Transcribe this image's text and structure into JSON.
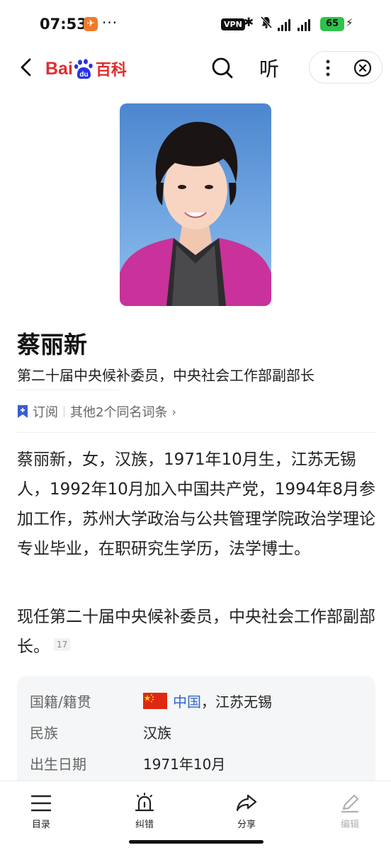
{
  "status_bar": {
    "time": "07:53",
    "notification_app_glyph": "✈",
    "dots": "···",
    "vpn_label": "VPN",
    "battery": "65",
    "icons": [
      "bluetooth-icon",
      "mute-icon",
      "signal-icon",
      "signal-icon",
      "charging-icon"
    ]
  },
  "header": {
    "logo_bai": "Bai",
    "logo_du": "du",
    "logo_cn": "百科",
    "listen_label": "听",
    "icons": [
      "back-icon",
      "search-icon",
      "more-icon",
      "close-icon"
    ]
  },
  "entry": {
    "title": "蔡丽新",
    "subtitle": "第二十届中央候补委员，中央社会工作部副部长",
    "subscribe_label": "订阅",
    "other_entries_label": "其他2个同名词条",
    "chevron": "›"
  },
  "content": {
    "para1": "蔡丽新，女，汉族，1971年10月生，江苏无锡人，1992年10月加入中国共产党，1994年8月参加工作，苏州大学政治与公共管理学院政治学理论专业毕业，在职研究生学历，法学博士。",
    "para2": "现任第二十届中央候补委员，中央社会工作部副部长。",
    "citation": "17"
  },
  "infobox": {
    "rows": [
      {
        "key": "国籍/籍贯",
        "value_link": "中国",
        "value_rest": "，江苏无锡"
      },
      {
        "key": "民族",
        "value": "汉族"
      },
      {
        "key": "出生日期",
        "value": "1971年10月"
      }
    ]
  },
  "bottom_bar": {
    "tabs": [
      {
        "label": "目录",
        "icon": "menu-icon"
      },
      {
        "label": "纠错",
        "icon": "alarm-icon"
      },
      {
        "label": "分享",
        "icon": "share-icon"
      },
      {
        "label": "编辑",
        "icon": "edit-icon"
      }
    ]
  },
  "colors": {
    "accent_red": "#e02d2d",
    "baidu_blue": "#2932e1",
    "link_blue": "#3466c7",
    "battery_green": "#2ec24b",
    "portrait_bg": "#5a93d6"
  }
}
